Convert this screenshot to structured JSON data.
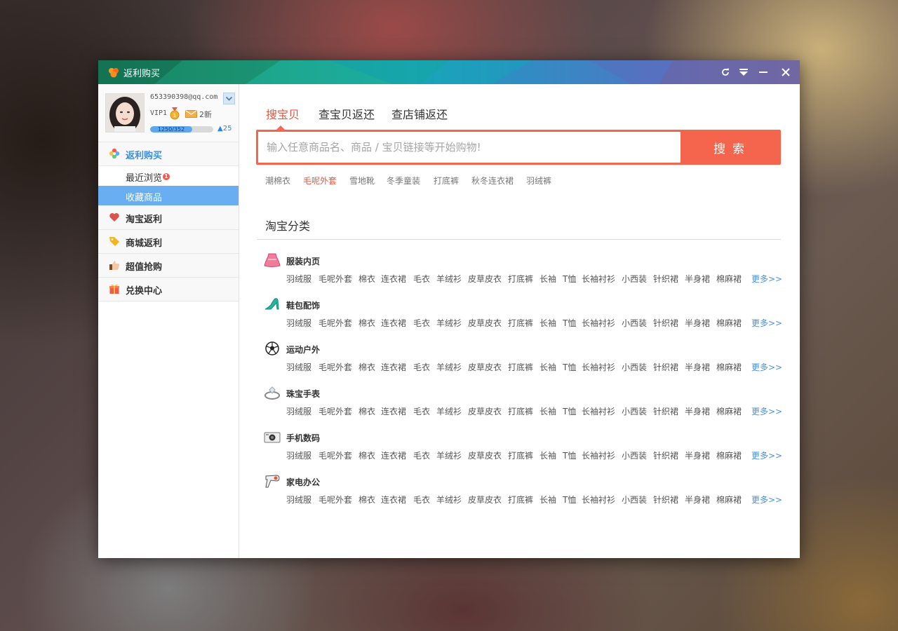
{
  "window": {
    "title": "返利购买"
  },
  "profile": {
    "email": "653390398@qq.com",
    "vip": "VIP1",
    "messages": "2新",
    "progress_text": "1250/352",
    "progress_fraction": 0.67,
    "level_up": "25"
  },
  "sidebar": {
    "header": "返利购买",
    "subitems": [
      {
        "label": "最近浏览",
        "badge": "1"
      },
      {
        "label": "收藏商品"
      }
    ],
    "items": [
      {
        "label": "淘宝返利",
        "icon": "heart-icon"
      },
      {
        "label": "商城返利",
        "icon": "tag-icon"
      },
      {
        "label": "超值抢购",
        "icon": "thumbs-up-icon"
      },
      {
        "label": "兑换中心",
        "icon": "gift-icon"
      }
    ]
  },
  "tabs": [
    "搜宝贝",
    "查宝贝返还",
    "查店铺返还"
  ],
  "search": {
    "placeholder": "输入任意商品名、商品 / 宝贝链接等开始购物!",
    "button": "搜索"
  },
  "hot_keywords": [
    "潮棉衣",
    "毛呢外套",
    "雪地靴",
    "冬季童装",
    "打底裤",
    "秋冬连衣裙",
    "羽绒裤"
  ],
  "section_title": "淘宝分类",
  "category_links": [
    "羽绒服",
    "毛呢外套",
    "棉衣",
    "连衣裙",
    "毛衣",
    "羊绒衫",
    "皮草皮衣",
    "打底裤",
    "长袖",
    "T恤",
    "长袖衬衫",
    "小西装",
    "针织裙",
    "半身裙",
    "棉麻裙"
  ],
  "more_label": "更多>>",
  "categories": [
    {
      "name": "服装内页",
      "icon": "skirt-icon"
    },
    {
      "name": "鞋包配饰",
      "icon": "high-heel-icon"
    },
    {
      "name": "运动户外",
      "icon": "soccer-ball-icon"
    },
    {
      "name": "珠宝手表",
      "icon": "ring-icon"
    },
    {
      "name": "手机数码",
      "icon": "camera-icon"
    },
    {
      "name": "家电办公",
      "icon": "hair-dryer-icon"
    }
  ],
  "colors": {
    "accent": "#f5644c",
    "selected": "#69aef0",
    "link_more": "#4a90d9"
  }
}
